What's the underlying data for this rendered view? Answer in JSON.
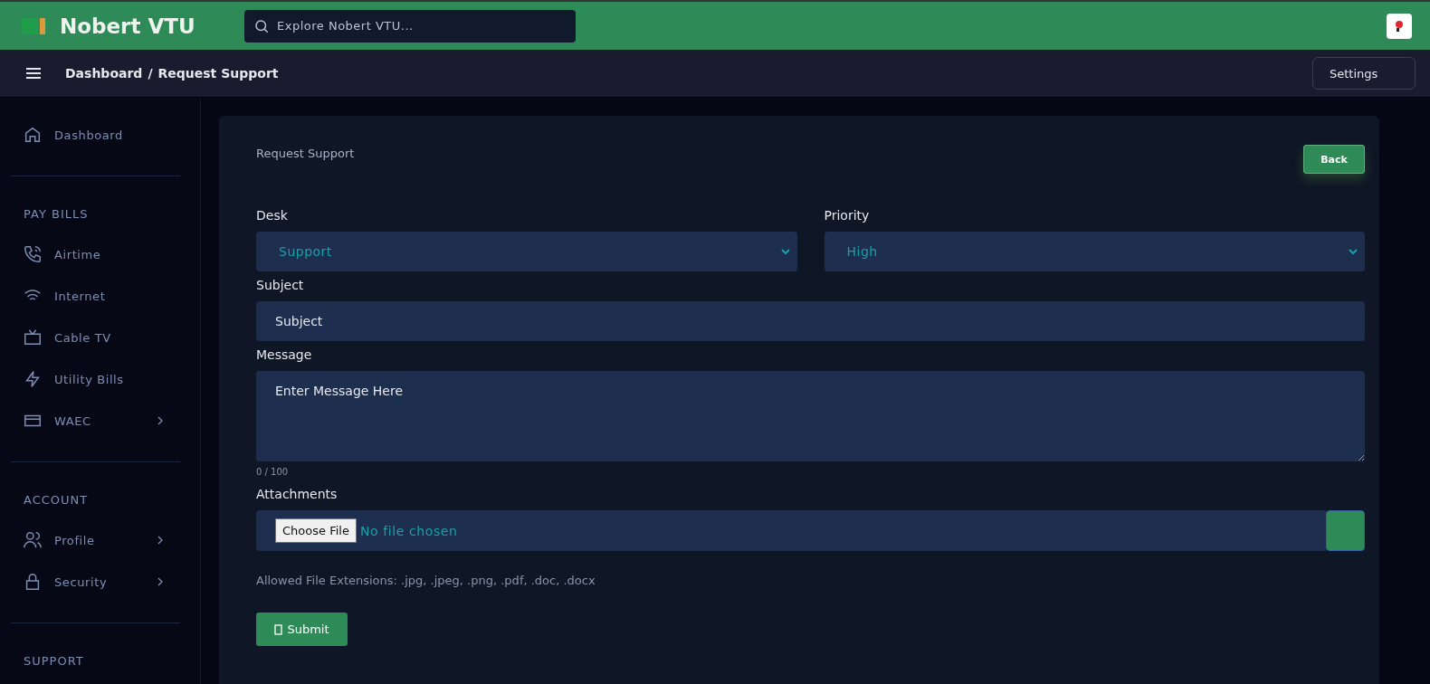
{
  "header": {
    "brand": "Nobert VTU",
    "search": {
      "placeholder": "Explore Nobert VTU..."
    }
  },
  "breadcrumb": {
    "parent": "Dashboard",
    "separator": "/",
    "current": "Request Support"
  },
  "settings_button": "Settings",
  "sidebar": {
    "sections": [
      {
        "items": [
          {
            "label": "Dashboard",
            "has_submenu": false
          }
        ]
      },
      {
        "title": "PAY BILLS",
        "items": [
          {
            "label": "Airtime",
            "has_submenu": false
          },
          {
            "label": "Internet",
            "has_submenu": false
          },
          {
            "label": "Cable TV",
            "has_submenu": false
          },
          {
            "label": "Utility Bills",
            "has_submenu": false
          },
          {
            "label": "WAEC",
            "has_submenu": true
          }
        ]
      },
      {
        "title": "ACCOUNT",
        "items": [
          {
            "label": "Profile",
            "has_submenu": true
          },
          {
            "label": "Security",
            "has_submenu": true
          }
        ]
      },
      {
        "title": "SUPPORT"
      }
    ]
  },
  "form": {
    "title": "Request Support",
    "back_button": "Back",
    "desk": {
      "label": "Desk",
      "value": "Support"
    },
    "priority": {
      "label": "Priority",
      "value": "High"
    },
    "subject": {
      "label": "Subject",
      "placeholder": "Subject"
    },
    "message": {
      "label": "Message",
      "placeholder": "Enter Message Here",
      "counter": "0 / 100"
    },
    "attachments": {
      "label": "Attachments",
      "choose_button": "Choose File",
      "status": "No file chosen"
    },
    "allowed_note": "Allowed File Extensions: .jpg, .jpeg, .png, .pdf, .doc, .docx",
    "submit_button": "Submit"
  }
}
